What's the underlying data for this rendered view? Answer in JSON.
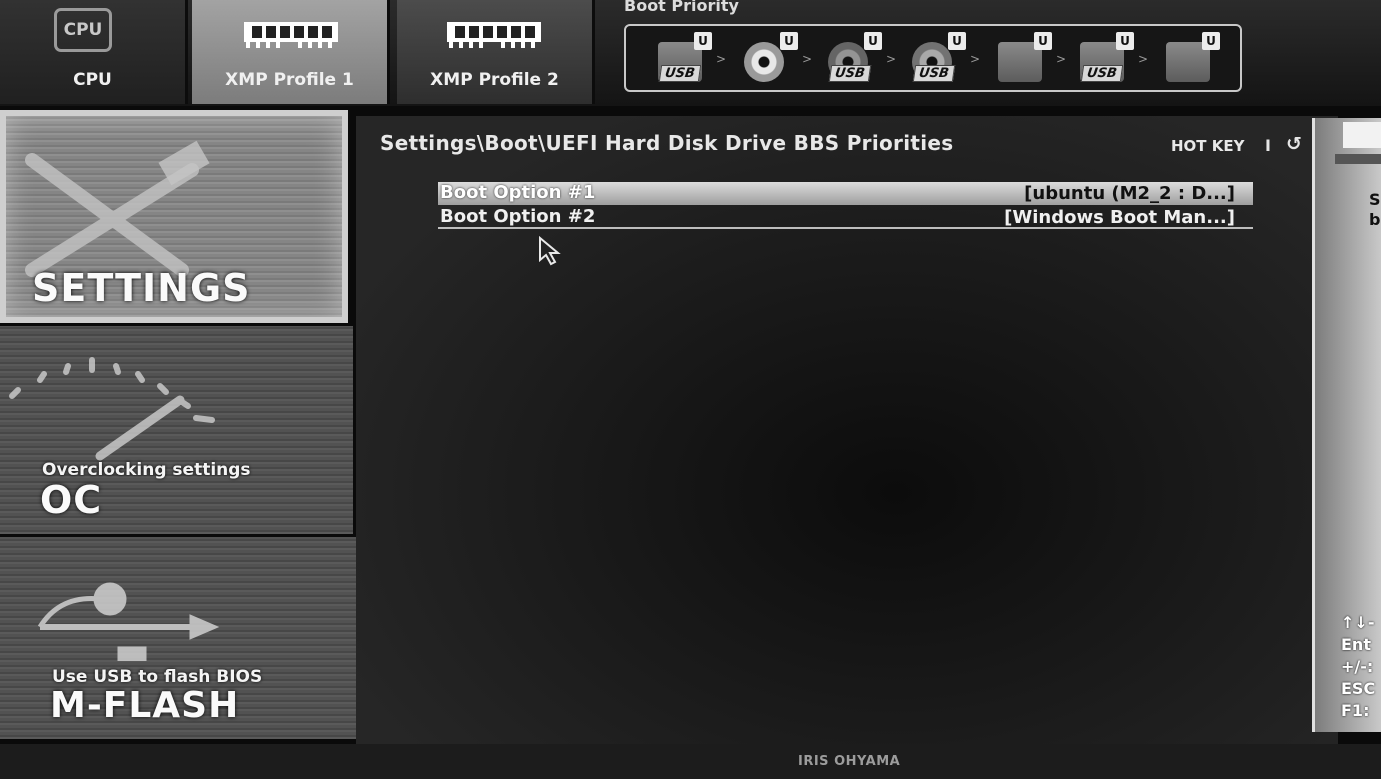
{
  "top_tabs": [
    {
      "label": "CPU",
      "icon": "cpu-chip-icon",
      "chip_text": "CPU"
    },
    {
      "label": "XMP Profile 1",
      "icon": "memory-module-icon"
    },
    {
      "label": "XMP Profile 2",
      "icon": "memory-module-icon"
    }
  ],
  "boot_priority": {
    "title": "Boot Priority",
    "badge": "U",
    "devices": [
      {
        "icon": "usb-drive-icon",
        "tag": "USB"
      },
      {
        "icon": "optical-disc-icon"
      },
      {
        "icon": "usb-hard-disk-icon",
        "tag": "USB"
      },
      {
        "icon": "usb-optical-disc-icon",
        "tag": "USB"
      },
      {
        "icon": "hard-disk-icon"
      },
      {
        "icon": "usb-floppy-icon",
        "tag": "USB"
      },
      {
        "icon": "network-device-icon"
      }
    ]
  },
  "sidebar": {
    "settings": {
      "title": "SETTINGS",
      "icon": "tools-icon"
    },
    "oc": {
      "subtitle": "Overclocking settings",
      "title": "OC",
      "icon": "gauge-icon"
    },
    "mflash": {
      "subtitle": "Use USB to flash BIOS",
      "title": "M-FLASH",
      "icon": "usb-icon"
    }
  },
  "main": {
    "breadcrumb": "Settings\\Boot\\UEFI Hard Disk Drive BBS Priorities",
    "hotkey_label": "HOT KEY",
    "hotkey_sep": "I",
    "back_icon": "↺",
    "options": [
      {
        "label": "Boot Option #1",
        "value": "[ubuntu (M2_2 : D...]",
        "selected": true
      },
      {
        "label": "Boot Option #2",
        "value": "[Windows Boot Man...]",
        "selected": false
      }
    ]
  },
  "right_panel": {
    "help_text": "S\nb",
    "keys": "↑↓-\nEnt\n+/-:\nESC\nF1:"
  },
  "monitor": {
    "brand": "IRIS OHYAMA"
  }
}
